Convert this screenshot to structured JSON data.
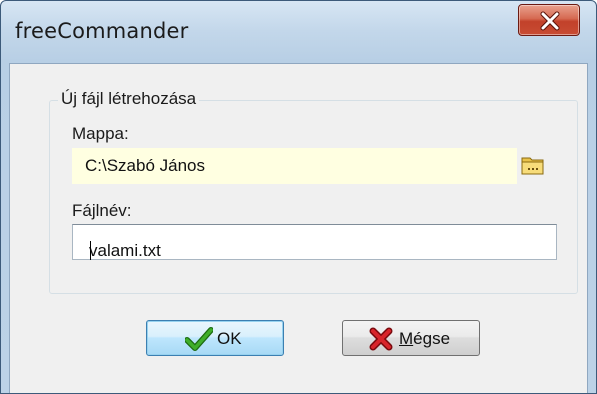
{
  "window": {
    "title": "freeCommander",
    "close_icon": "close-icon"
  },
  "group": {
    "legend": "Új fájl létrehozása"
  },
  "folder": {
    "label": "Mappa:",
    "value": "C:\\Szabó János",
    "browse_icon": "folder-icon"
  },
  "filename": {
    "label": "Fájlnév:",
    "value": "valami.txt"
  },
  "buttons": {
    "ok_label": "OK",
    "ok_icon": "checkmark-icon",
    "cancel_accel": "M",
    "cancel_rest": "égse",
    "cancel_icon": "red-x-icon"
  },
  "colors": {
    "folder_field_bg": "#ffffe1",
    "close_button": "#c84c33",
    "ok_check": "#2c8a1e",
    "cancel_x": "#c0141a"
  }
}
